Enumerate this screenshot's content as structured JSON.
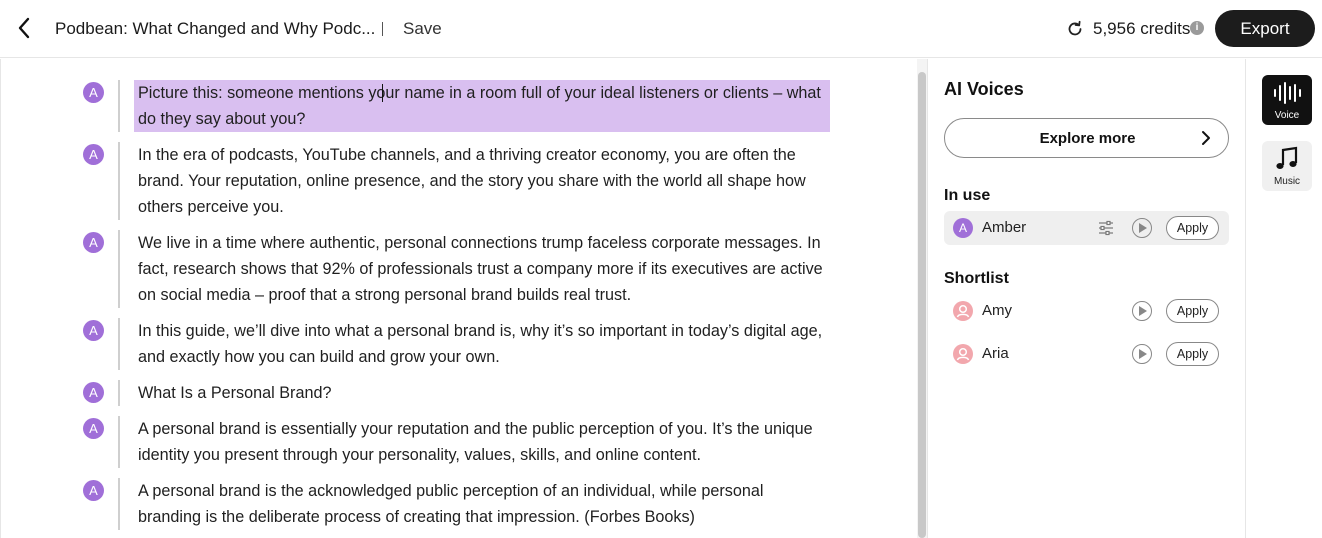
{
  "header": {
    "title": "Podbean: What Changed and Why Podc...",
    "save_label": "Save",
    "credits": "5,956 credits",
    "info_glyph": "i",
    "export_label": "Export"
  },
  "editor": {
    "paragraphs": [
      {
        "avatar": "A",
        "text": "Picture this: someone mentions your name in a room full of your ideal listeners or clients – what do they say about you?",
        "highlighted": true
      },
      {
        "avatar": "A",
        "text": "In the era of podcasts, YouTube channels, and a thriving creator economy, you are often the brand. Your reputation, online presence, and the story you share with the world all shape how others perceive you."
      },
      {
        "avatar": "A",
        "text": "We live in a time where authentic, personal connections trump faceless corporate messages. In fact, research shows that 92% of professionals trust a company more if its executives are active on social media – proof that a strong personal brand builds real trust."
      },
      {
        "avatar": "A",
        "text": "In this guide, we’ll dive into what a personal brand is, why it’s so important in today’s digital age, and exactly how you can build and grow your own."
      },
      {
        "avatar": "A",
        "text": "What Is a Personal Brand?"
      },
      {
        "avatar": "A",
        "text": "A personal brand is essentially your reputation and the public perception of you. It’s the unique identity you present through your personality, values, skills, and online content."
      },
      {
        "avatar": "A",
        "text": "A personal brand is the acknowledged public perception of an individual, while personal branding is the deliberate process of creating that impression. (Forbes Books)"
      }
    ]
  },
  "panel": {
    "title": "AI Voices",
    "explore_label": "Explore more",
    "in_use_label": "In use",
    "in_use": [
      {
        "name": "Amber",
        "avatar": "A",
        "apply_label": "Apply"
      }
    ],
    "shortlist_label": "Shortlist",
    "shortlist": [
      {
        "name": "Amy",
        "apply_label": "Apply"
      },
      {
        "name": "Aria",
        "apply_label": "Apply"
      }
    ]
  },
  "rail": {
    "voice_label": "Voice",
    "music_label": "Music"
  },
  "colors": {
    "accent": "#a06fd8",
    "highlight": "#d9bff0",
    "export_bg": "#1c1c1c"
  }
}
